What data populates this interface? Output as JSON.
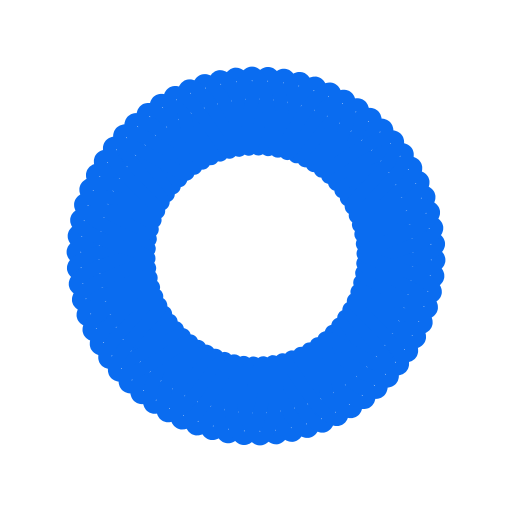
{
  "logo": {
    "icon": "rosette-lattice-logo-icon",
    "color": "#0A6CF0",
    "background": "#FFFFFF",
    "petals": 14,
    "strands": 5
  }
}
